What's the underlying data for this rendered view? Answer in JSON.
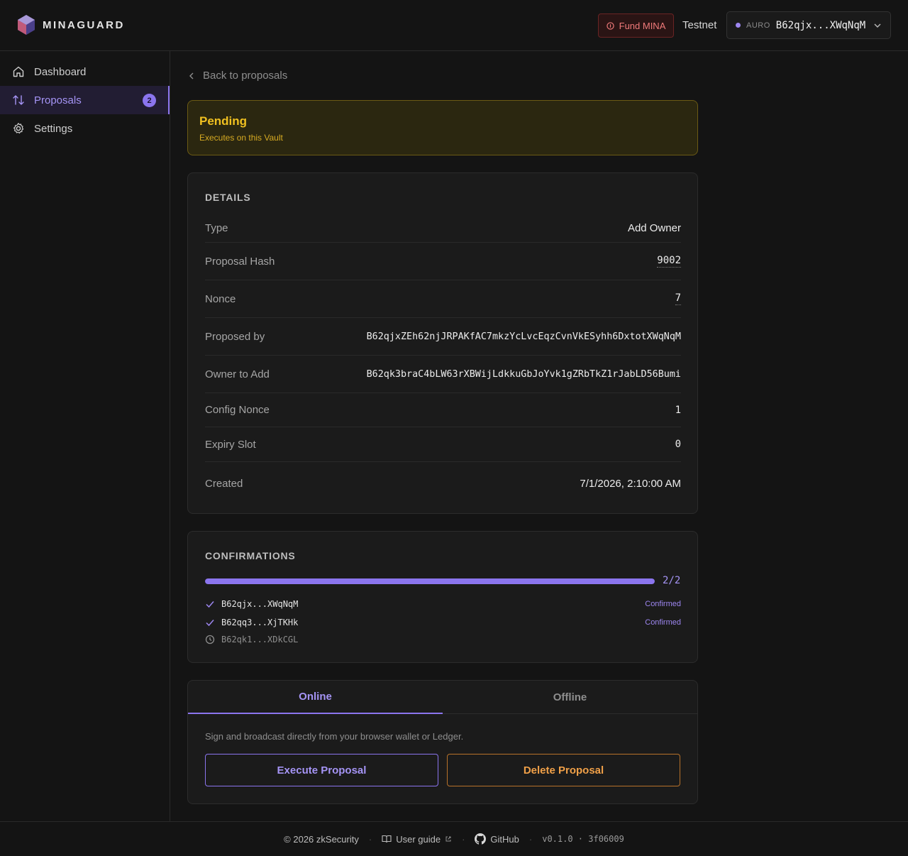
{
  "header": {
    "brand": "MINAGUARD",
    "fund_label": "Fund MINA",
    "network": "Testnet",
    "wallet_brand": "AURO",
    "wallet_address": "B62qjx...XWqNqM"
  },
  "sidebar": {
    "items": [
      {
        "label": "Dashboard"
      },
      {
        "label": "Proposals",
        "badge": "2"
      },
      {
        "label": "Settings"
      }
    ]
  },
  "main": {
    "back_label": "Back to proposals",
    "status": {
      "title": "Pending",
      "subtitle": "Executes on this Vault",
      "color": "#f0c020"
    },
    "details": {
      "title": "DETAILS",
      "rows": [
        {
          "label": "Type",
          "value": "Add Owner"
        },
        {
          "label": "Proposal Hash",
          "value": "9002"
        },
        {
          "label": "Nonce",
          "value": "7"
        },
        {
          "label": "Proposed by",
          "value": "B62qjxZEh62njJRPAKfAC7mkzYcLvcEqzCvnVkESyhh6DxtotXWqNqM"
        },
        {
          "label": "Owner to Add",
          "value": "B62qk3braC4bLW63rXBWijLdkkuGbJoYvk1gZRbTkZ1rJabLD56Bumi"
        },
        {
          "label": "Config Nonce",
          "value": "1"
        },
        {
          "label": "Expiry Slot",
          "value": "0"
        },
        {
          "label": "Created",
          "value": "7/1/2026, 2:10:00 AM"
        }
      ]
    },
    "confirmations": {
      "title": "CONFIRMATIONS",
      "progress_fraction": 1.0,
      "progress_text": "2/2",
      "signers": [
        {
          "address": "B62qjx...XWqNqM",
          "status": "Confirmed",
          "icon": "check-icon"
        },
        {
          "address": "B62qq3...XjTKHk",
          "status": "Confirmed",
          "icon": "check-icon"
        },
        {
          "address": "B62qk1...XDkCGL",
          "status": "",
          "icon": "clock-icon"
        }
      ]
    },
    "actions": {
      "tabs": [
        "Online",
        "Offline"
      ],
      "active_tab": "Online",
      "description": "Sign and broadcast directly from your browser wallet or Ledger.",
      "execute_label": "Execute Proposal",
      "delete_label": "Delete Proposal"
    }
  },
  "footer": {
    "copyright": "© 2026 zkSecurity",
    "user_guide": "User guide",
    "github": "GitHub",
    "version": "v0.1.0 · 3f06009"
  },
  "colors": {
    "accent": "#8b75ee",
    "warning": "#f0c020",
    "danger": "#f07a7a",
    "delete": "#f0a048"
  }
}
